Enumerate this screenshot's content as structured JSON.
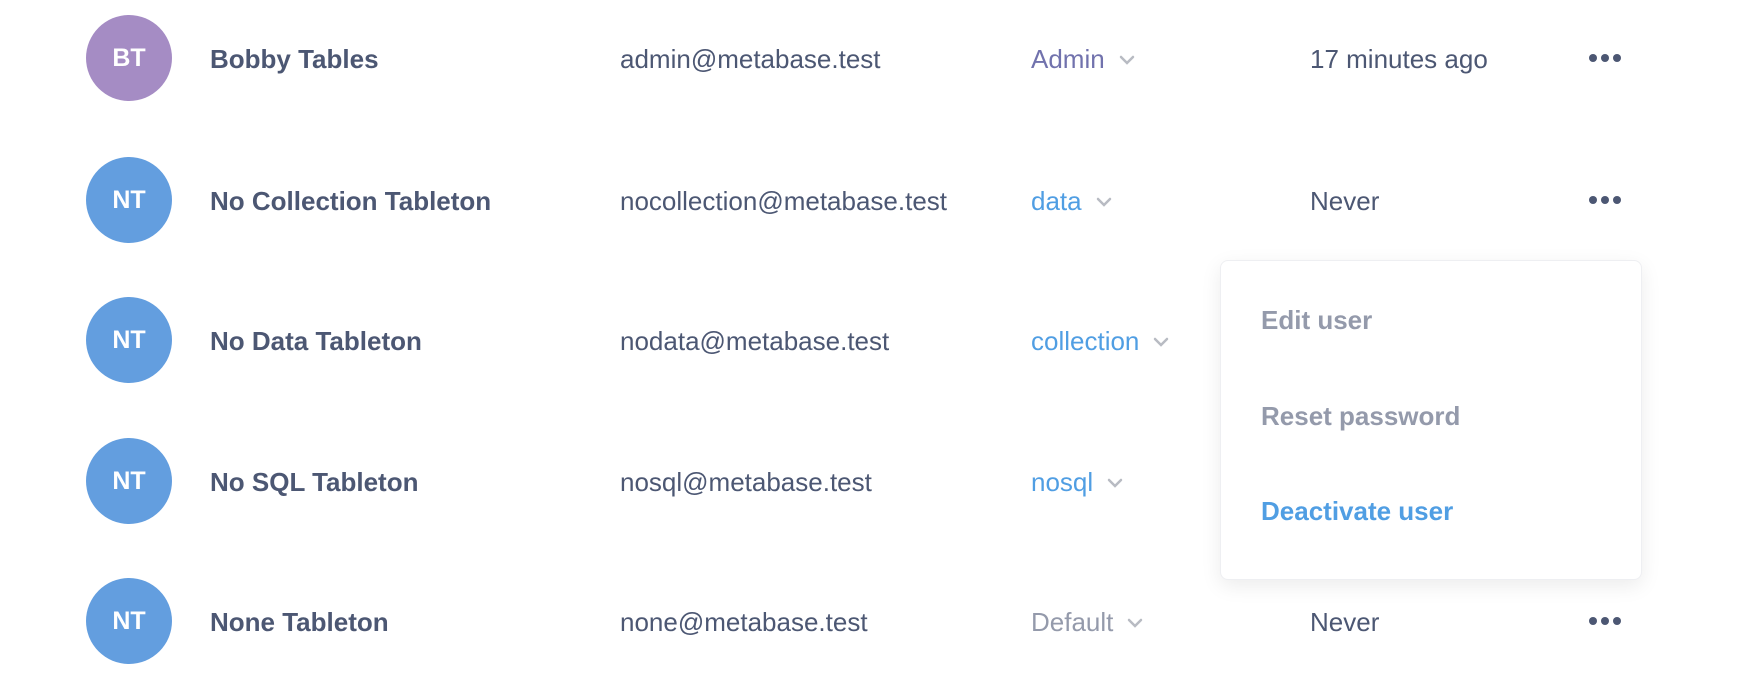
{
  "colors": {
    "text": "#4c5773",
    "admin": "#7172ad",
    "group": "#509ee3",
    "default": "#949aab",
    "avatar_admin": "#a58cc4",
    "avatar_user": "#639edf",
    "menu_muted": "#949aab",
    "menu_danger": "#509ee3"
  },
  "users": [
    {
      "initials": "BT",
      "name": "Bobby Tables",
      "email": "admin@metabase.test",
      "role": "Admin",
      "role_type": "admin",
      "last_login": "17 minutes ago"
    },
    {
      "initials": "NT",
      "name": "No Collection Tableton",
      "email": "nocollection@metabase.test",
      "role": "data",
      "role_type": "group",
      "last_login": "Never"
    },
    {
      "initials": "NT",
      "name": "No Data Tableton",
      "email": "nodata@metabase.test",
      "role": "collection",
      "role_type": "group",
      "last_login": ""
    },
    {
      "initials": "NT",
      "name": "No SQL Tableton",
      "email": "nosql@metabase.test",
      "role": "nosql",
      "role_type": "group",
      "last_login": ""
    },
    {
      "initials": "NT",
      "name": "None Tableton",
      "email": "none@metabase.test",
      "role": "Default",
      "role_type": "default",
      "last_login": "Never"
    }
  ],
  "menu": {
    "edit": "Edit user",
    "reset": "Reset password",
    "deactivate": "Deactivate user"
  },
  "icons": {
    "role_toggle": "chevron-down-icon",
    "actions": "ellipsis-icon"
  }
}
